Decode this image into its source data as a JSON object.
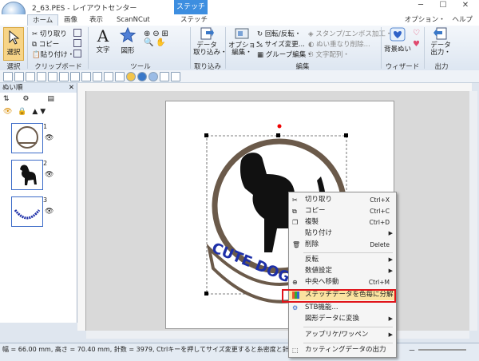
{
  "window": {
    "title": "2_63.PES - レイアウトセンター",
    "context_tab": "ステッチ"
  },
  "tabs": [
    "ホーム",
    "画像",
    "表示",
    "ScanNCut",
    "ステッチ"
  ],
  "help_links": {
    "option": "オプション・",
    "help": "ヘルプ"
  },
  "ribbon": {
    "select_group": {
      "label": "選択",
      "button": "選択"
    },
    "clipboard_group": {
      "label": "クリップボード",
      "cut": "切り取り",
      "copy": "コピー",
      "paste": "貼り付け・"
    },
    "tools_group": {
      "label": "ツール",
      "text": "文字",
      "shape": "図形"
    },
    "import_group": {
      "label": "取り込み",
      "import": "データ\n取り込み・"
    },
    "edit_group": {
      "label": "編集",
      "option": "オプション\n編集・",
      "rotate": "回転/反転・",
      "resize": "サイズ変更...",
      "group": "グループ編集・",
      "stamp": "スタンプ/エンボス加工・",
      "remove_overlap": "ぬい重なり削除...",
      "text_arrange": "文字配列・"
    },
    "wizard_group": {
      "label": "ウィザード",
      "background": "背景ぬい"
    },
    "output_group": {
      "label": "出力",
      "output": "データ\n出力・"
    }
  },
  "panel": {
    "title": "ぬい順",
    "items": [
      "1",
      "2",
      "3"
    ]
  },
  "design": {
    "badge_text": "CUTE DOG"
  },
  "context_menu": {
    "items": [
      {
        "label": "切り取り",
        "shortcut": "Ctrl+X"
      },
      {
        "label": "コピー",
        "shortcut": "Ctrl+C"
      },
      {
        "label": "複製",
        "shortcut": "Ctrl+D"
      },
      {
        "label": "貼り付け",
        "shortcut": ""
      },
      {
        "label": "削除",
        "shortcut": "Delete"
      },
      {
        "label": "反転",
        "shortcut": ""
      },
      {
        "label": "数値設定",
        "shortcut": ""
      },
      {
        "label": "中央へ移動",
        "shortcut": "Ctrl+M"
      },
      {
        "label": "ステッチデータを色毎に分解",
        "shortcut": ""
      },
      {
        "label": "STB機能...",
        "shortcut": ""
      },
      {
        "label": "図形データに変換",
        "shortcut": ""
      },
      {
        "label": "アップリケ/ワッペン",
        "shortcut": ""
      },
      {
        "label": "カッティングデータの出力",
        "shortcut": ""
      }
    ]
  },
  "status_bar": {
    "text": "幅 = 66.00 mm, 高さ = 70.40 mm, 針数 = 3979, Ctrlキーを押してサイズ変更すると糸密度と針落ちパターンが保持",
    "zoom_minus": "－"
  },
  "colors": {
    "accent": "#3d8ee0",
    "highlight_border": "#e0141b",
    "thread_brown": "#6b5a4a",
    "thread_blue": "#1d2fa8"
  }
}
